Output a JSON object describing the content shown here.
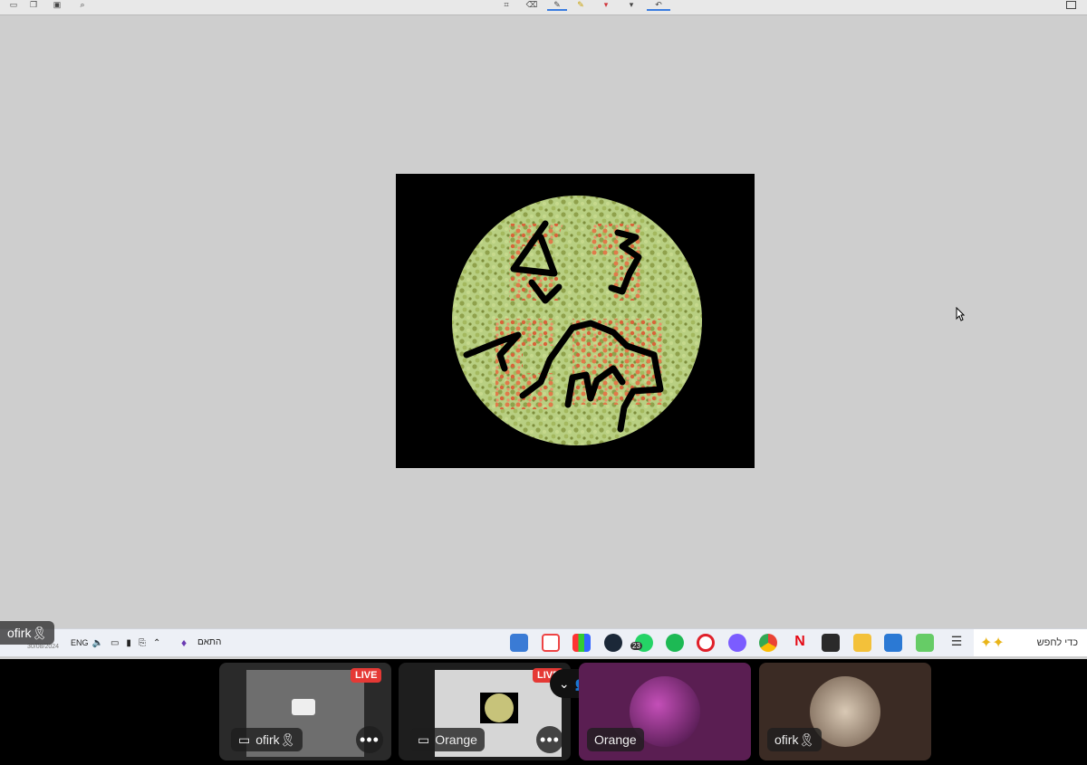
{
  "viewer": {
    "toolbar_icons": [
      "crop-icon",
      "eraser-icon",
      "pen-icon",
      "highlighter-icon",
      "marker-icon",
      "pen-dark-icon",
      "undo-icon"
    ]
  },
  "overlay": {
    "presenter_name": "ofirk🎗"
  },
  "taskbar": {
    "language": "ENG",
    "tray_date": "30/08/2024",
    "weather_label": "התאם",
    "search_placeholder": "כדי לחפש",
    "badge_count": "23"
  },
  "participants": [
    {
      "name": "ofirk🎗",
      "live_label": "LIVE"
    },
    {
      "name": "Orange",
      "live_label": "LIVE"
    },
    {
      "name": "Orange"
    },
    {
      "name": "ofirk🎗"
    }
  ],
  "colors": {
    "live": "#e53935",
    "tile_purple": "#5a1e52",
    "tile_brown": "#3b2b24",
    "screen_bg": "#cecece"
  }
}
